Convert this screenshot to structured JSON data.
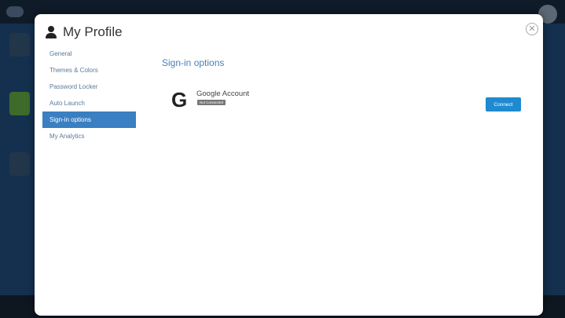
{
  "modal": {
    "title": "My Profile",
    "close_icon": "close-circle-icon"
  },
  "nav": {
    "items": [
      {
        "label": "General",
        "active": false
      },
      {
        "label": "Themes & Colors",
        "active": false
      },
      {
        "label": "Password Locker",
        "active": false
      },
      {
        "label": "Auto Launch",
        "active": false
      },
      {
        "label": "Sign-in options",
        "active": true
      },
      {
        "label": "My Analytics",
        "active": false
      }
    ]
  },
  "content": {
    "section_title": "Sign-in options",
    "account": {
      "icon": "google-g-icon",
      "name": "Google Account",
      "status": "Not Connected",
      "action_label": "Connect"
    }
  },
  "colors": {
    "accent": "#3a7fc1",
    "button": "#1f8ad0",
    "badge": "#777777"
  }
}
